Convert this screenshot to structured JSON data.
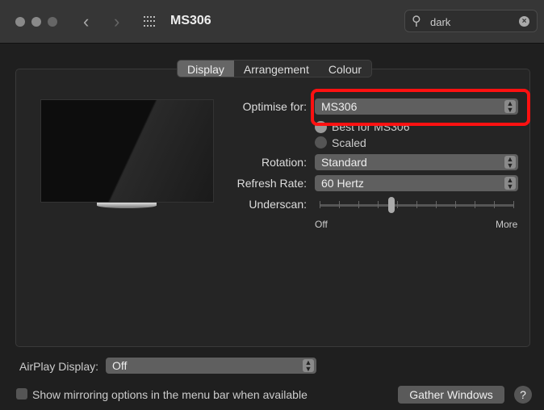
{
  "window": {
    "title": "MS306",
    "search_value": "dark"
  },
  "tabs": [
    "Display",
    "Arrangement",
    "Colour"
  ],
  "selected_tab": "Display",
  "display": {
    "optimise_label": "Optimise for:",
    "optimise_value": "MS306",
    "radio_best": "Best for MS306",
    "radio_scaled": "Scaled",
    "rotation_label": "Rotation:",
    "rotation_value": "Standard",
    "refresh_label": "Refresh Rate:",
    "refresh_value": "60 Hertz",
    "underscan_label": "Underscan:",
    "underscan_min": "Off",
    "underscan_max": "More",
    "underscan_level": 0.37
  },
  "footer": {
    "airplay_label": "AirPlay Display:",
    "airplay_value": "Off",
    "mirror_label": "Show mirroring options in the menu bar when available",
    "mirror_checked": false,
    "gather_label": "Gather Windows",
    "help_label": "?"
  },
  "highlight_color": "#f11111"
}
